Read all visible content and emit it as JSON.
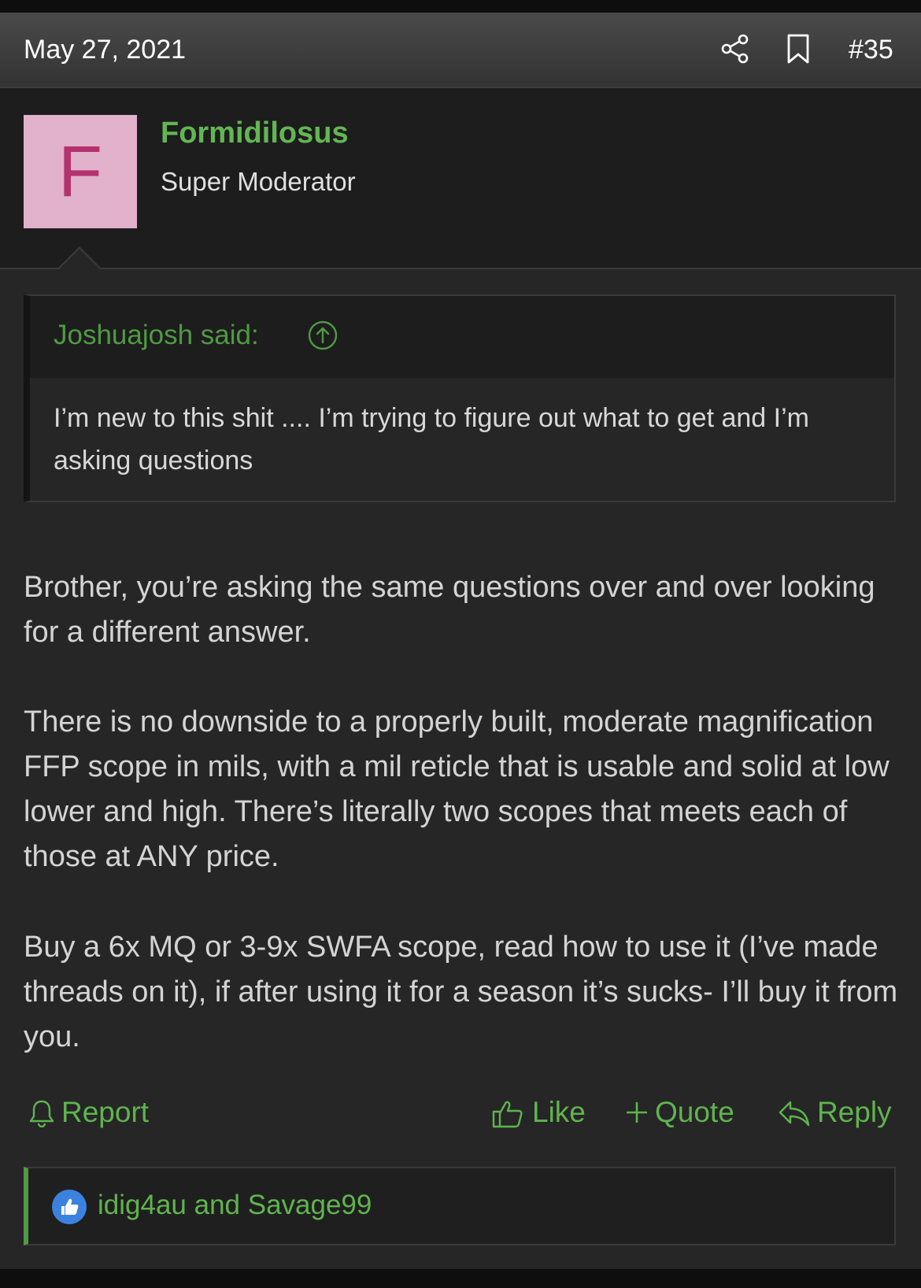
{
  "header": {
    "date": "May 27, 2021",
    "post_number": "#35",
    "share_icon": "share-icon",
    "bookmark_icon": "bookmark-icon"
  },
  "user": {
    "avatar_letter": "F",
    "name": "Formidilosus",
    "title": "Super Moderator",
    "avatar_bg": "#e2b1cc",
    "name_color": "#62b653"
  },
  "quote": {
    "author": "Joshuajosh said:",
    "body": "I’m new to this shit .... I’m trying to figure out what to get and I’m asking questions"
  },
  "message": {
    "paragraphs": [
      "Brother, you’re asking the same questions over and over looking for a different answer.",
      "There is no downside to a properly built, moderate magnification FFP scope in mils, with a mil reticle that is usable and solid at low lower and high. There’s literally two scopes that meets each of those at ANY price.",
      "Buy a 6x MQ or 3-9x SWFA scope, read how to use it (I’ve made threads on it), if after using it for a season it’s sucks- I’ll buy it from you."
    ]
  },
  "actions": {
    "report": "Report",
    "like": "Like",
    "quote": "Quote",
    "reply": "Reply",
    "accent": "#5fb44e"
  },
  "reactions": {
    "users": "idig4au and Savage99"
  }
}
